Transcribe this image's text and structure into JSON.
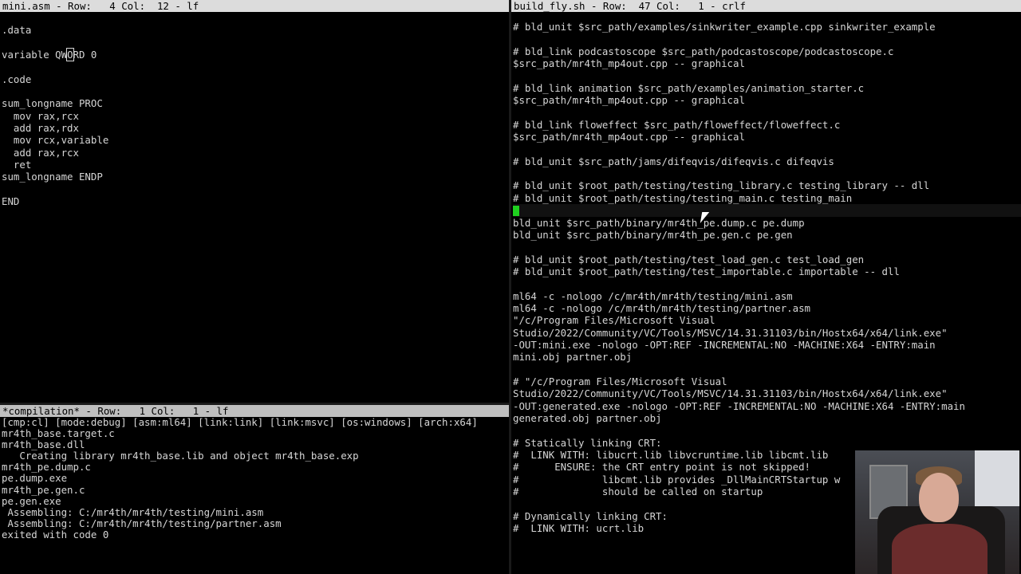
{
  "left_top_pane": {
    "modeline": "mini.asm - Row:   4 Col:  12 - lf",
    "lines": [
      "",
      ".data",
      "",
      "variable QWORD 0",
      "",
      ".code",
      "",
      "sum_longname PROC",
      "  mov rax,rcx",
      "  add rax,rdx",
      "  mov rcx,variable",
      "  add rax,rcx",
      "  ret",
      "sum_longname ENDP",
      "",
      "END"
    ],
    "cursor_line_prefix": "variable QW",
    "cursor_char": "O",
    "cursor_line_suffix": "RD 0"
  },
  "compilation_pane": {
    "modeline": "*compilation* - Row:   1 Col:   1 - lf",
    "lines": [
      "[cmp:cl] [mode:debug] [asm:ml64] [link:link] [link:msvc] [os:windows] [arch:x64]",
      "mr4th_base.target.c",
      "mr4th_base.dll",
      "   Creating library mr4th_base.lib and object mr4th_base.exp",
      "mr4th_pe.dump.c",
      "pe.dump.exe",
      "mr4th_pe.gen.c",
      "pe.gen.exe",
      " Assembling: C:/mr4th/mr4th/testing/mini.asm",
      " Assembling: C:/mr4th/mr4th/testing/partner.asm",
      "exited with code 0"
    ]
  },
  "right_pane": {
    "modeline": "build_fly.sh - Row:  47 Col:   1 - crlf",
    "lines": [
      "# bld_unit $src_path/examples/sinkwriter_example.cpp sinkwriter_example",
      "",
      "# bld_link podcastoscope $src_path/podcastoscope/podcastoscope.c",
      "$src_path/mr4th_mp4out.cpp -- graphical",
      "",
      "# bld_link animation $src_path/examples/animation_starter.c",
      "$src_path/mr4th_mp4out.cpp -- graphical",
      "",
      "# bld_link floweffect $src_path/floweffect/floweffect.c",
      "$src_path/mr4th_mp4out.cpp -- graphical",
      "",
      "# bld_unit $src_path/jams/difeqvis/difeqvis.c difeqvis",
      "",
      "# bld_unit $root_path/testing/testing_library.c testing_library -- dll",
      "# bld_unit $root_path/testing/testing_main.c testing_main",
      "",
      "bld_unit $src_path/binary/mr4th_pe.dump.c pe.dump",
      "bld_unit $src_path/binary/mr4th_pe.gen.c pe.gen",
      "",
      "# bld_unit $root_path/testing/test_load_gen.c test_load_gen",
      "# bld_unit $root_path/testing/test_importable.c importable -- dll",
      "",
      "ml64 -c -nologo /c/mr4th/mr4th/testing/mini.asm",
      "ml64 -c -nologo /c/mr4th/mr4th/testing/partner.asm",
      "\"/c/Program Files/Microsoft Visual",
      "Studio/2022/Community/VC/Tools/MSVC/14.31.31103/bin/Hostx64/x64/link.exe\"",
      "-OUT:mini.exe -nologo -OPT:REF -INCREMENTAL:NO -MACHINE:X64 -ENTRY:main",
      "mini.obj partner.obj",
      "",
      "# \"/c/Program Files/Microsoft Visual",
      "Studio/2022/Community/VC/Tools/MSVC/14.31.31103/bin/Hostx64/x64/link.exe\"",
      "-OUT:generated.exe -nologo -OPT:REF -INCREMENTAL:NO -MACHINE:X64 -ENTRY:main",
      "generated.obj partner.obj",
      "",
      "# Statically linking CRT:",
      "#  LINK WITH: libucrt.lib libvcruntime.lib libcmt.lib",
      "#      ENSURE: the CRT entry point is not skipped!",
      "#              libcmt.lib provides _DllMainCRTStartup w",
      "#              should be called on startup",
      "",
      "# Dynamically linking CRT:",
      "#  LINK WITH: ucrt.lib"
    ],
    "cursor_line_index": 15
  },
  "colors": {
    "background": "#000000",
    "text": "#d6d6d6",
    "modeline": "#dcdcdc",
    "cursor": "#1fd11f"
  }
}
